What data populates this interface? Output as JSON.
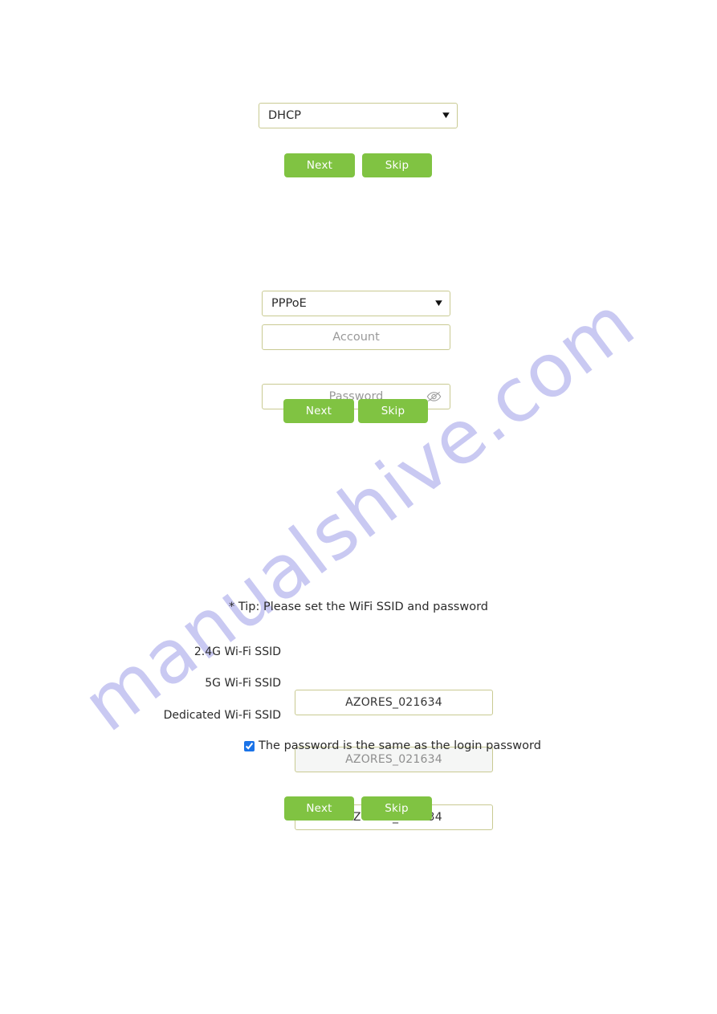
{
  "watermark": {
    "text": "manualshive.com",
    "color": "#c9c9f2"
  },
  "theme": {
    "button_green": "#80c342",
    "field_border": "#c9ca92",
    "disabled_bg": "#f5f6f5",
    "checkbox_blue": "#1a73e8"
  },
  "section_dhcp": {
    "mode_select": {
      "value": "DHCP",
      "caret_icon": "chevron-down-icon"
    },
    "next_label": "Next",
    "skip_label": "Skip"
  },
  "section_pppoe": {
    "mode_select": {
      "value": "PPPoE",
      "caret_icon": "chevron-down-icon"
    },
    "account_field": {
      "value": "",
      "placeholder": "Account"
    },
    "password_field": {
      "value": "",
      "placeholder": "Password",
      "toggle_icon": "eye-slash-icon"
    },
    "next_label": "Next",
    "skip_label": "Skip"
  },
  "section_wifi": {
    "tip": "* Tip: Please set the WiFi SSID and password",
    "rows": [
      {
        "label": "2.4G Wi-Fi SSID",
        "value": "AZORES_021634",
        "disabled": false
      },
      {
        "label": "5G Wi-Fi SSID",
        "value": "AZORES_021634",
        "disabled": true
      },
      {
        "label": "Dedicated Wi-Fi SSID",
        "value": "AZORES_021634",
        "disabled": false
      }
    ],
    "same_password_checkbox": {
      "label": "The password is the same as the login password",
      "checked": true
    },
    "next_label": "Next",
    "skip_label": "Skip"
  }
}
